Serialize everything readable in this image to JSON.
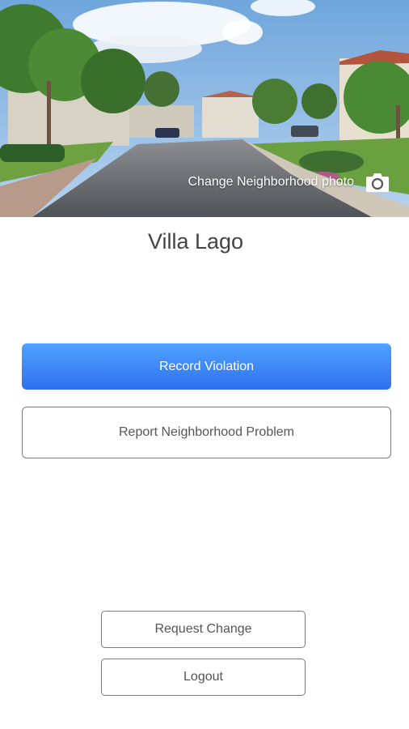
{
  "header": {
    "change_photo_label": "Change Neighborhood photo",
    "camera_icon": "camera-icon"
  },
  "neighborhood": {
    "name": "Villa Lago"
  },
  "actions": {
    "record_violation": "Record Violation",
    "report_problem": "Report Neighborhood Problem",
    "request_change": "Request Change",
    "logout": "Logout"
  },
  "colors": {
    "primary_top": "#4fa3ff",
    "primary_bottom": "#2f6ff0",
    "button_border": "#7a7a7a"
  }
}
